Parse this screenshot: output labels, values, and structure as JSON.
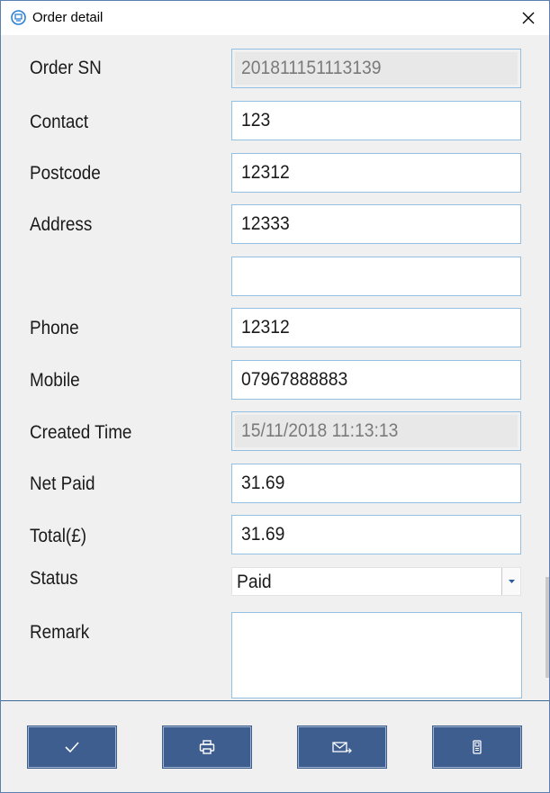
{
  "window": {
    "title": "Order detail",
    "icons": {
      "app": "app-globe-icon",
      "close": "close-icon"
    }
  },
  "form": {
    "order_sn": {
      "label": "Order SN",
      "value": "201811151113139",
      "readonly": true
    },
    "contact": {
      "label": "Contact",
      "value": "123"
    },
    "postcode": {
      "label": "Postcode",
      "value": "12312"
    },
    "address": {
      "label": "Address",
      "value": "12333",
      "line2": ""
    },
    "phone": {
      "label": "Phone",
      "value": "12312"
    },
    "mobile": {
      "label": "Mobile",
      "value": "07967888883"
    },
    "created_time": {
      "label": "Created Time",
      "value": "15/11/2018 11:13:13",
      "readonly": true
    },
    "net_paid": {
      "label": "Net Paid",
      "value": "31.69"
    },
    "total": {
      "label": "Total(£)",
      "value": "31.69"
    },
    "status": {
      "label": "Status",
      "value": "Paid"
    },
    "remark": {
      "label": "Remark",
      "value": ""
    }
  },
  "footer": {
    "buttons": [
      {
        "icon": "checkmark-icon"
      },
      {
        "icon": "printer-icon"
      },
      {
        "icon": "email-icon"
      },
      {
        "icon": "mobile-phone-icon"
      }
    ]
  },
  "colors": {
    "button_bg": "#3d5e8e",
    "field_border": "#93bfe0",
    "divider": "#3c6b9b"
  }
}
